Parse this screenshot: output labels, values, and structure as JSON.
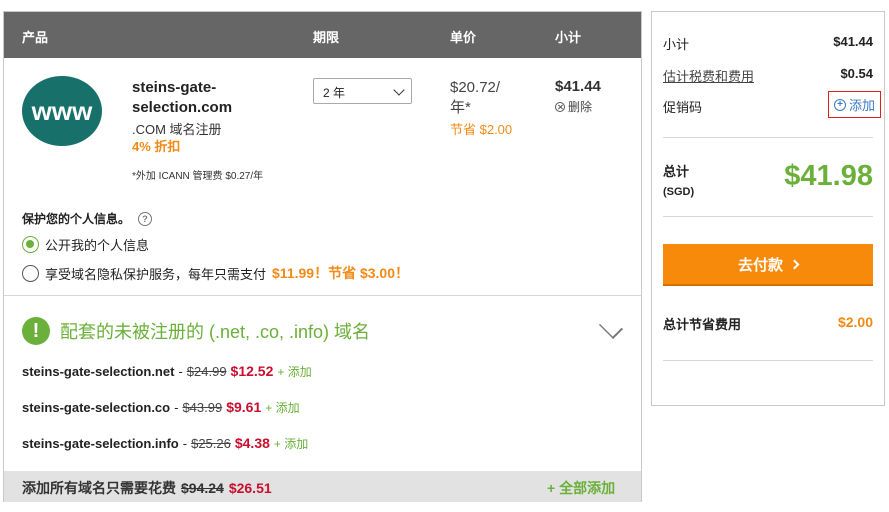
{
  "cart": {
    "headers": {
      "product": "产品",
      "period": "期限",
      "unit_price": "单价",
      "subtotal": "小计"
    },
    "item": {
      "logo_text": "www",
      "domain": "steins-gate-selection.com",
      "domain_line1": "steins-gate-",
      "domain_line2": "selection.com",
      "tld_label": ".COM 域名注册",
      "discount": "4% 折扣",
      "icann_note": "*外加 ICANN 管理费 $0.27/年",
      "period_selected": "2 年",
      "unit_price_line1": "$20.72/",
      "unit_price_line2": "年*",
      "unit_savings": "节省 $2.00",
      "line_total": "$41.44",
      "remove_label": "删除"
    },
    "privacy": {
      "title": "保护您的个人信息。",
      "help_icon": "?",
      "option_public": "公开我的个人信息",
      "option_private_text": "享受域名隐私保护服务，每年只需支付",
      "option_private_price": "$11.99！节省 $3.00！",
      "selected": "public"
    },
    "related": {
      "alert_icon": "!",
      "title": "配套的未被注册的 (.net, .co, .info) 域名",
      "items": [
        {
          "name": "steins-gate-selection.net",
          "sep": "-",
          "old_price": "$24.99",
          "new_price": "$12.52",
          "add_label": "+ 添加"
        },
        {
          "name": "steins-gate-selection.co",
          "sep": "-",
          "old_price": "$43.99",
          "new_price": "$9.61",
          "add_label": "+ 添加"
        },
        {
          "name": "steins-gate-selection.info",
          "sep": "-",
          "old_price": "$25.26",
          "new_price": "$4.38",
          "add_label": "+ 添加"
        }
      ]
    },
    "footer": {
      "label": "添加所有域名只需要花费",
      "old_total": "$94.24",
      "new_total": "$26.51",
      "add_all": "+ 全部添加"
    }
  },
  "summary": {
    "subtotal_label": "小计",
    "subtotal_value": "$41.44",
    "fees_label": "估计税费和费用",
    "fees_value": "$0.54",
    "promo_label": "促销码",
    "promo_add": "添加",
    "total_label": "总计",
    "currency": "(SGD)",
    "total_value": "$41.98",
    "pay_button": "去付款",
    "savings_label": "总计节省费用",
    "savings_value": "$2.00"
  },
  "colors": {
    "header_bg": "#666666",
    "brand_teal": "#17716a",
    "accent_green": "#6ab03a",
    "accent_orange": "#f28a16",
    "pay_button": "#f78a0b",
    "sale_red": "#c8102e",
    "link_blue": "#3a79c4",
    "highlight_red": "#e0201a"
  }
}
